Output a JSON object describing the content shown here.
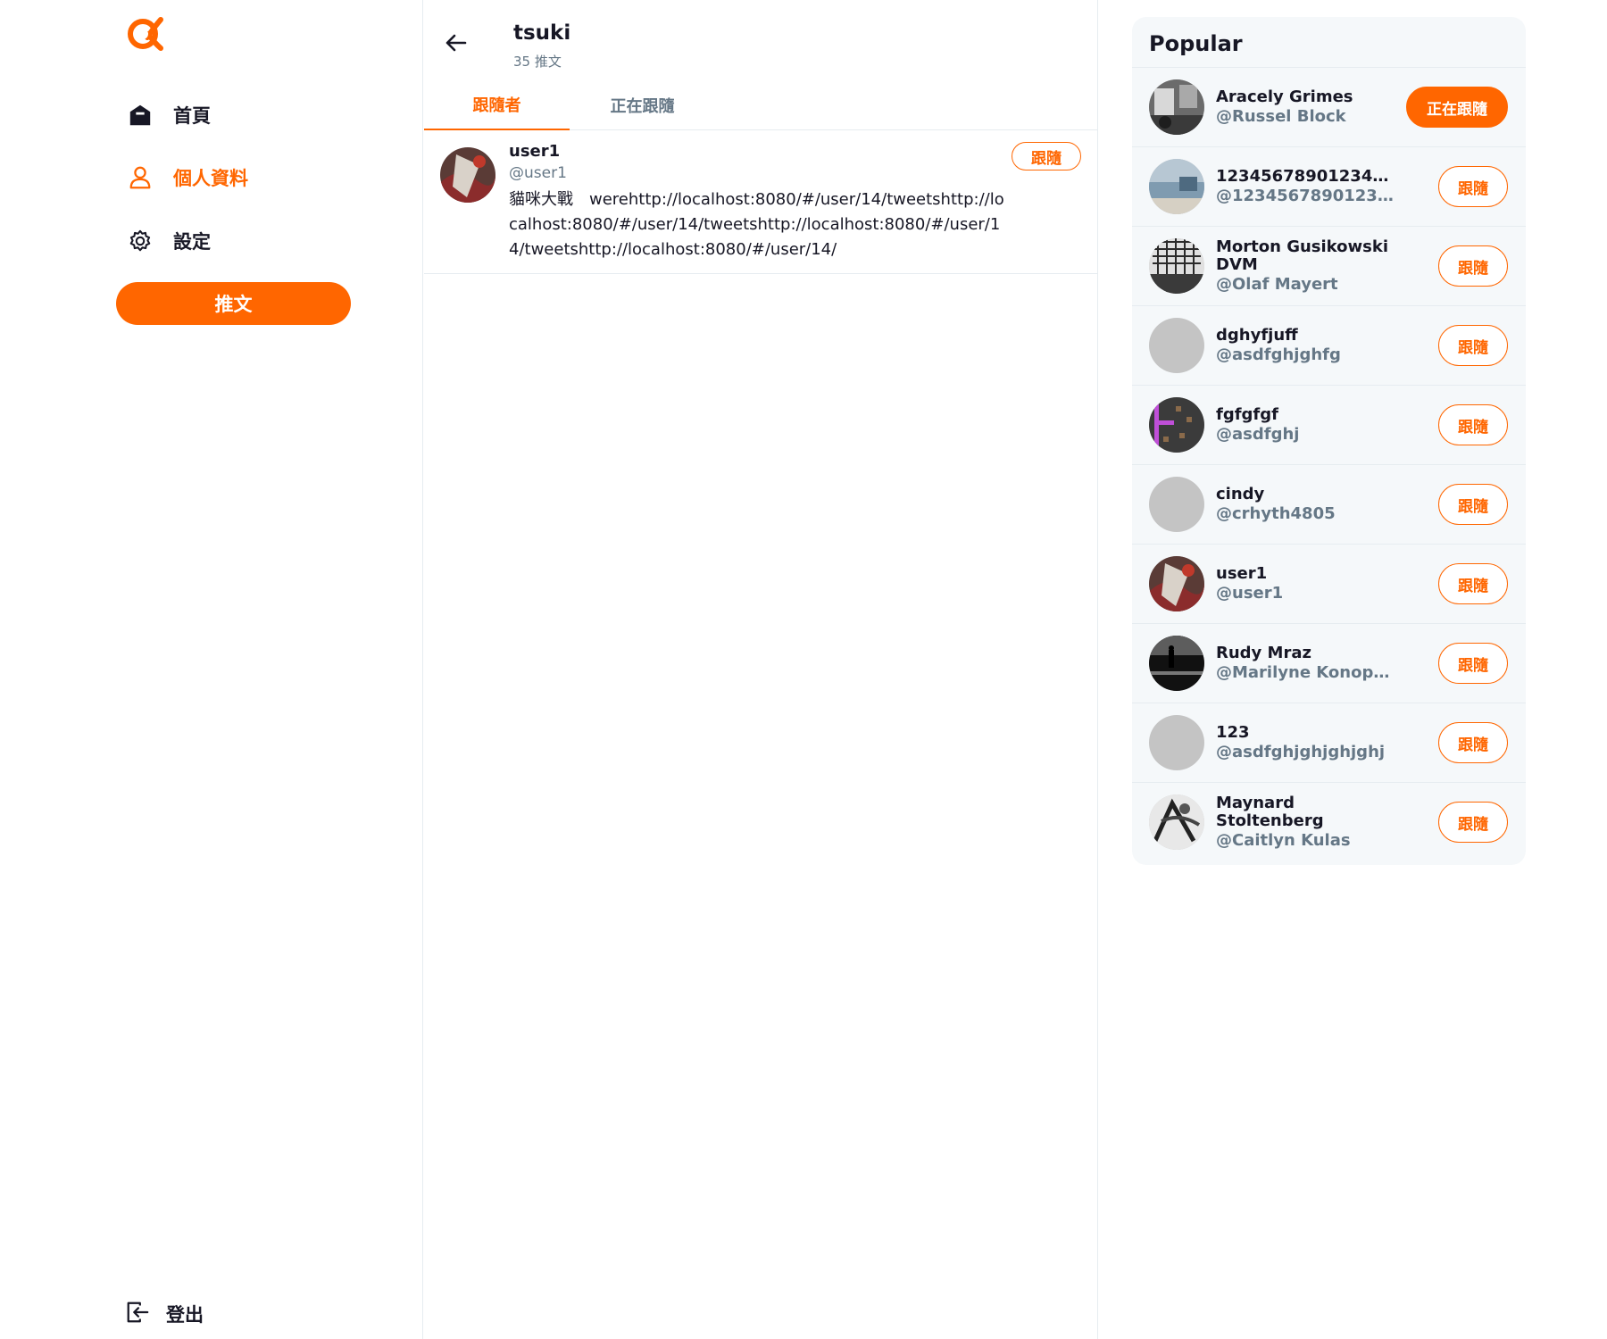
{
  "sidebar": {
    "logo_icon": "alpha-logo-icon",
    "nav": [
      {
        "label": "首頁",
        "icon": "home-icon",
        "active": false
      },
      {
        "label": "個人資料",
        "icon": "user-icon",
        "active": true
      },
      {
        "label": "設定",
        "icon": "gear-icon",
        "active": false
      }
    ],
    "tweet_button_label": "推文",
    "logout_label": "登出"
  },
  "main": {
    "profile_name": "tsuki",
    "tweet_count": "35 推文",
    "tabs": [
      {
        "label": "跟隨者",
        "active": true
      },
      {
        "label": "正在跟隨",
        "active": false
      }
    ],
    "users": [
      {
        "name": "user1",
        "handle": "@user1",
        "bio": "貓咪大戰　werehttp://localhost:8080/#/user/14/tweetshttp://localhost:8080/#/user/14/tweetshttp://localhost:8080/#/user/14/tweetshttp://localhost:8080/#/user/14/",
        "follow_label": "跟隨"
      }
    ]
  },
  "popular": {
    "title": "Popular",
    "users": [
      {
        "name": "Aracely Grimes",
        "handle": "@Russel Block",
        "button": "正在跟隨",
        "following": true
      },
      {
        "name": "12345678901234567...",
        "handle": "@123456789012345...",
        "button": "跟隨",
        "following": false
      },
      {
        "name": "Morton Gusikowski DVM",
        "handle": "@Olaf Mayert",
        "button": "跟隨",
        "following": false
      },
      {
        "name": "dghyfjuff",
        "handle": "@asdfghjghfg",
        "button": "跟隨",
        "following": false
      },
      {
        "name": "fgfgfgf",
        "handle": "@asdfghj",
        "button": "跟隨",
        "following": false
      },
      {
        "name": "cindy",
        "handle": "@crhyth4805",
        "button": "跟隨",
        "following": false
      },
      {
        "name": "user1",
        "handle": "@user1",
        "button": "跟隨",
        "following": false
      },
      {
        "name": "Rudy Mraz",
        "handle": "@Marilyne Konopelski",
        "button": "跟隨",
        "following": false
      },
      {
        "name": "123",
        "handle": "@asdfghjghjghjghj",
        "button": "跟隨",
        "following": false
      },
      {
        "name": "Maynard Stoltenberg",
        "handle": "@Caitlyn Kulas",
        "button": "跟隨",
        "following": false
      }
    ]
  },
  "colors": {
    "accent": "#ff6600",
    "text": "#171725",
    "muted": "#657786",
    "border": "#e6ecf0",
    "panel": "#f5f8fa",
    "placeholder_avatar": "#c4c4c4"
  }
}
